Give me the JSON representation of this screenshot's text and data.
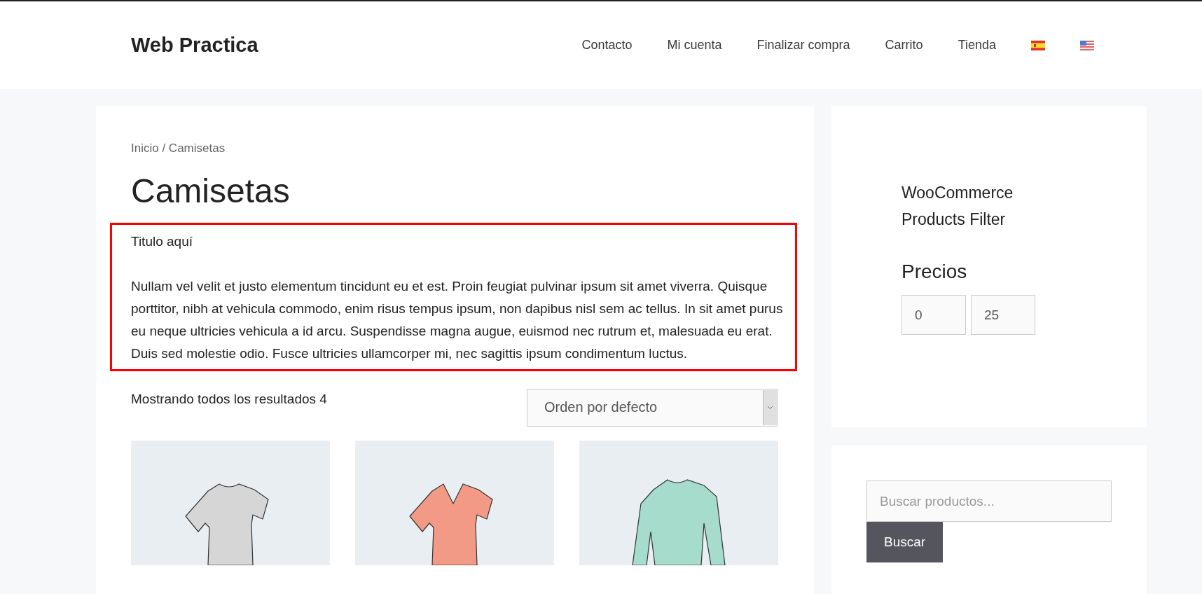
{
  "site": {
    "title": "Web Practica"
  },
  "nav": [
    {
      "label": "Contacto"
    },
    {
      "label": "Mi cuenta"
    },
    {
      "label": "Finalizar compra"
    },
    {
      "label": "Carrito"
    },
    {
      "label": "Tienda"
    }
  ],
  "breadcrumb": "Inicio / Camisetas",
  "page_title": "Camisetas",
  "description": {
    "title": "Titulo aquí",
    "text": "Nullam vel velit et justo elementum tincidunt eu et est. Proin feugiat pulvinar ipsum sit amet viverra. Quisque porttitor, nibh at vehicula commodo, enim risus tempus ipsum, non dapibus nisl sem ac tellus. In sit amet purus eu neque ultricies vehicula a id arcu. Suspendisse magna augue, euismod nec rutrum et, malesuada eu erat. Duis sed molestie odio. Fusce ultricies ullamcorper mi, nec sagittis ipsum condimentum luctus."
  },
  "result_count": "Mostrando todos los resultados 4",
  "sort": {
    "value": "Orden por defecto"
  },
  "products": [
    {
      "kind": "tshirt",
      "color": "#d6d6d6"
    },
    {
      "kind": "vneck",
      "color": "#f29a85"
    },
    {
      "kind": "longsleeve",
      "color": "#a6dccb"
    }
  ],
  "filter_widget": {
    "title": "WooCommerce Products Filter",
    "price_heading": "Precios",
    "min": "0",
    "max": "25"
  },
  "search": {
    "placeholder": "Buscar productos...",
    "button": "Buscar"
  }
}
